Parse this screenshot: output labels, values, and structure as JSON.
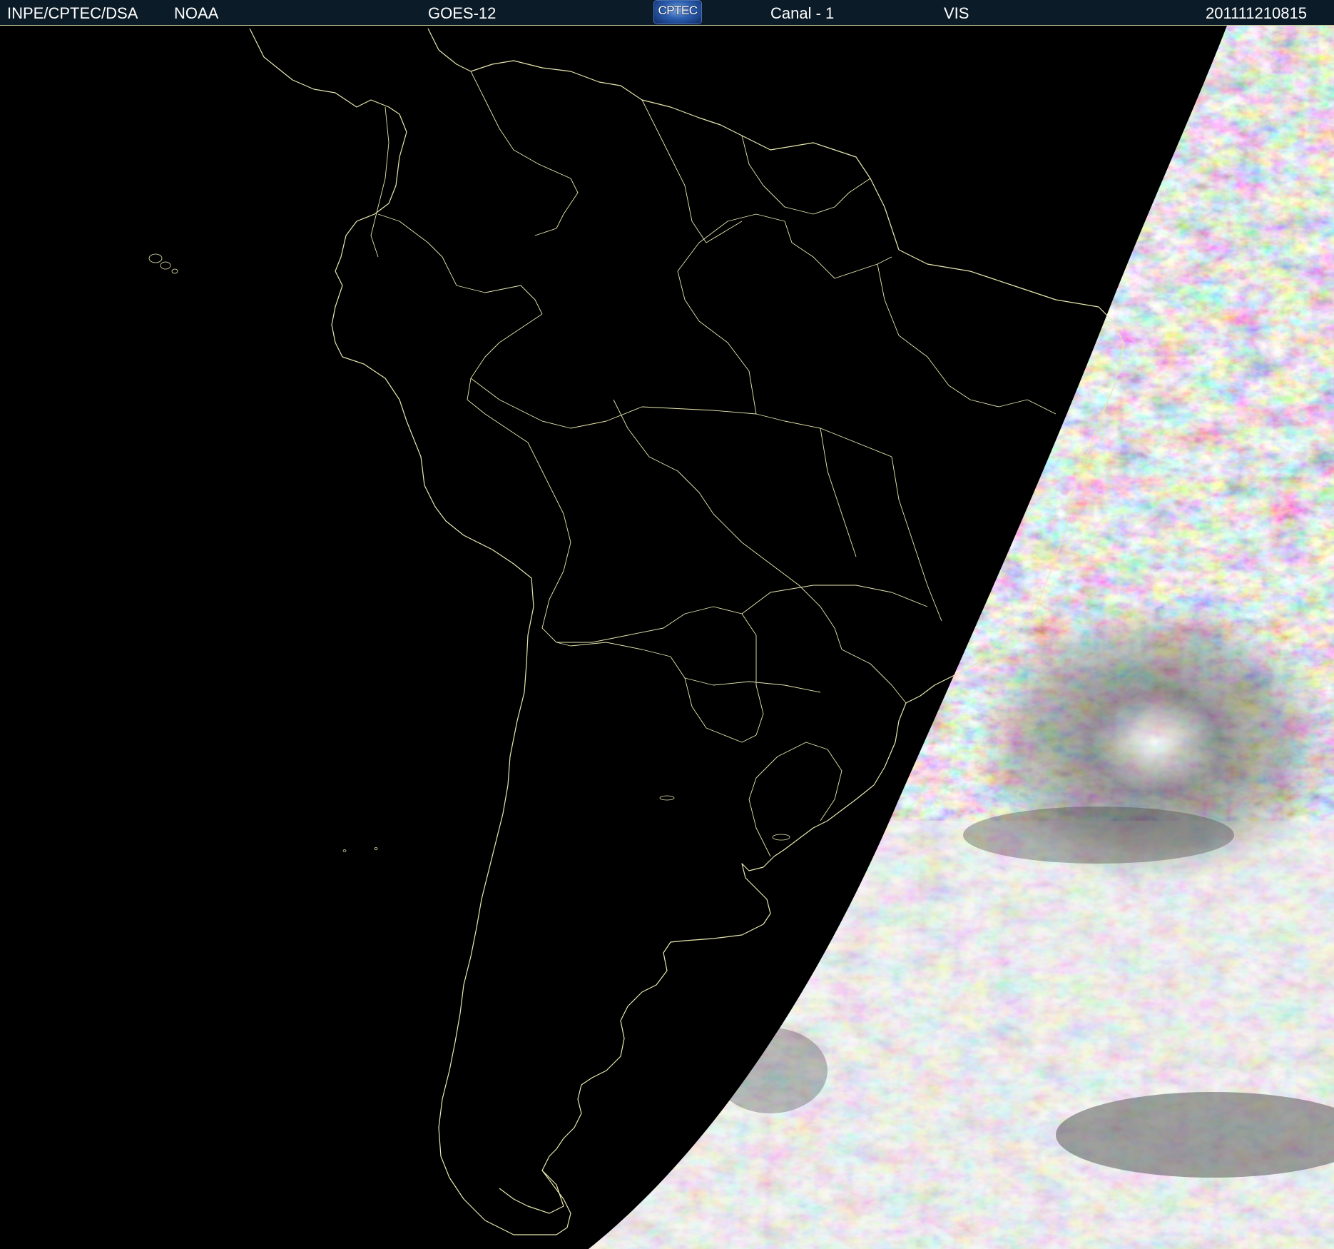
{
  "header": {
    "institution": "INPE/CPTEC/DSA",
    "agency": "NOAA",
    "satellite": "GOES-12",
    "logo_text": "CPTEC",
    "channel": "Canal - 1",
    "band": "VIS",
    "timestamp": "201111210815"
  },
  "map": {
    "region": "South America",
    "coastline_color": "#e8e8b0",
    "background_color": "#000000",
    "cloud_color": "#e6e6e6"
  }
}
